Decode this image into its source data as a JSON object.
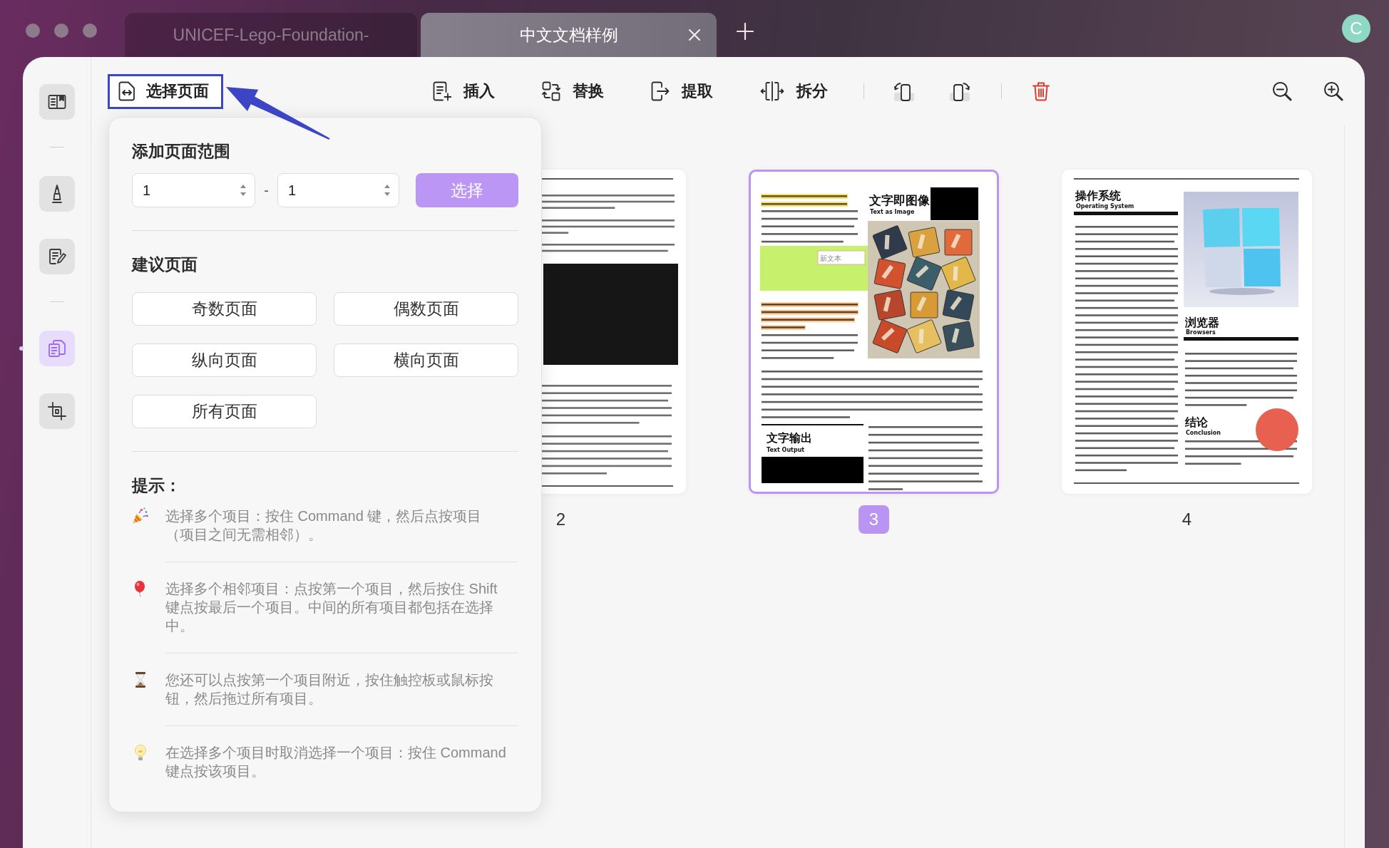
{
  "tabs": [
    {
      "label": "UNICEF-Lego-Foundation-",
      "selected": false
    },
    {
      "label": "中文文档样例",
      "selected": true
    }
  ],
  "account": {
    "initial": "C"
  },
  "sidebar": {
    "groups": [
      {
        "items": [
          {
            "selected": false
          }
        ]
      },
      {
        "items": [
          {
            "selected": false
          },
          {
            "selected": false
          }
        ]
      },
      {
        "items": [
          {
            "selected": true
          },
          {
            "selected": false
          }
        ]
      }
    ]
  },
  "toolbar": {
    "select_pages": {
      "label": "选择页面",
      "expanded": true,
      "annotated": true
    },
    "tools": [
      {
        "label": "插入"
      },
      {
        "label": "替换"
      },
      {
        "label": "提取"
      },
      {
        "label": "拆分"
      }
    ]
  },
  "popover": {
    "range_title": "添加页面范围",
    "from": "1",
    "separator": "-",
    "to": "1",
    "apply_button": "选择",
    "suggestions_title": "建议页面",
    "suggestions": [
      {
        "label": "奇数页面"
      },
      {
        "label": "偶数页面"
      },
      {
        "label": "纵向页面"
      },
      {
        "label": "横向页面"
      },
      {
        "label": "所有页面"
      }
    ],
    "tips_title": "提示：",
    "tips": [
      {
        "text": "选择多个项目：按住 Command 键，然后点按项目（项目之间无需相邻）。"
      },
      {
        "text": "选择多个相邻项目：点按第一个项目，然后按住 Shift 键点按最后一个项目。中间的所有项目都包括在选择中。"
      },
      {
        "text": "您还可以点按第一个项目附近，按住触控板或鼠标按钮，然后拖过所有项目。"
      },
      {
        "text": "在选择多个项目时取消选择一个项目：按住 Command 键点按该项目。"
      }
    ]
  },
  "pages": [
    {
      "label": "2",
      "selected": false,
      "kind": "photo-article"
    },
    {
      "label": "3",
      "selected": true,
      "kind": "text-as-image",
      "sections": [
        {
          "title": "文字即图像",
          "subtitle": "Text as Image"
        },
        {
          "title": "文字输出",
          "subtitle": "Text Output"
        }
      ],
      "text_box": "新文本"
    },
    {
      "label": "4",
      "selected": false,
      "kind": "three-sections",
      "sections": [
        {
          "title": "操作系统",
          "subtitle": "Operating System"
        },
        {
          "title": "浏览器",
          "subtitle": "Browsers"
        },
        {
          "title": "结论",
          "subtitle": "Conclusion"
        }
      ]
    }
  ]
}
